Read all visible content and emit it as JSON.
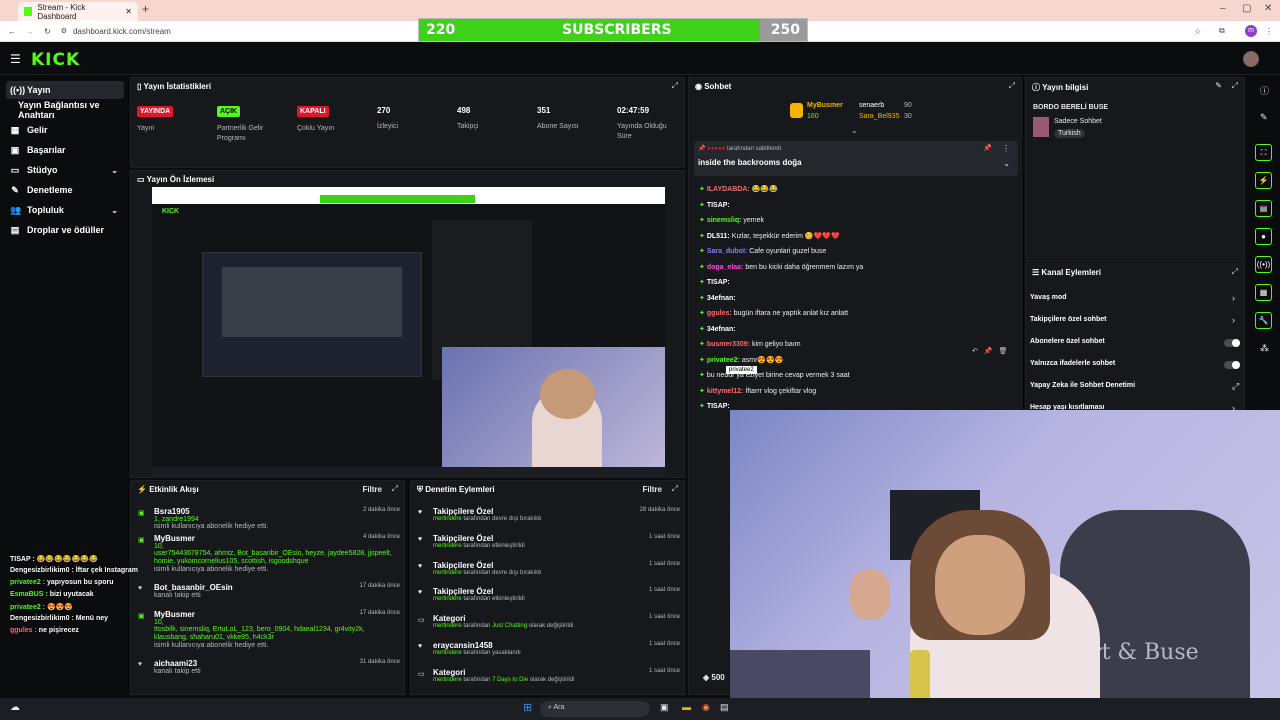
{
  "browser": {
    "tab_title": "Stream - Kick Dashboard",
    "url": "dashboard.kick.com/stream",
    "avatar_letter": "m"
  },
  "sub_overlay": {
    "current": "220",
    "label": "SUBSCRIBERS",
    "goal": "250",
    "progress": 0.88
  },
  "logo": "KICK",
  "sidebar": {
    "items": [
      {
        "label": "Yayın",
        "icon": "broadcast-icon"
      },
      {
        "label": "Yayın Bağlantısı ve Anahtarı",
        "icon": ""
      },
      {
        "label": "Gelir",
        "icon": "revenue-icon"
      },
      {
        "label": "Başarılar",
        "icon": "achievements-icon"
      },
      {
        "label": "Stüdyo",
        "icon": "studio-icon"
      },
      {
        "label": "Denetleme",
        "icon": "moderation-icon"
      },
      {
        "label": "Topluluk",
        "icon": "community-icon"
      },
      {
        "label": "Droplar ve ödüller",
        "icon": "drops-icon"
      }
    ]
  },
  "stats": {
    "title": "Yayın İstatistikleri",
    "items": [
      {
        "badge": "YAYINDA",
        "label": "Yayın"
      },
      {
        "badge": "AÇIK",
        "label": "Partnerlik Gelir Programı"
      },
      {
        "badge": "KAPALI",
        "label": "Çoklu Yayın"
      },
      {
        "value": "270",
        "label": "İzleyici"
      },
      {
        "value": "498",
        "label": "Takipçi"
      },
      {
        "value": "351",
        "label": "Abone Sayısı"
      },
      {
        "value": "02:47:59",
        "label": "Yayında Olduğu Süre"
      }
    ]
  },
  "preview": {
    "title": "Yayın Ön İzlemesi"
  },
  "chat": {
    "title": "Sohbet",
    "leader": {
      "name": "MyBusmer",
      "count": "160"
    },
    "top": [
      {
        "name": "senaerb",
        "count": "90"
      },
      {
        "name": "Sara_Bel935",
        "count": "30"
      }
    ],
    "pinned": {
      "by": "tarafından sabitlendi",
      "text": "inside the backrooms doğa"
    },
    "messages": [
      {
        "user": "ILAYDABDA:",
        "text": "😂😂😂",
        "color": "#ff6b6b"
      },
      {
        "user": "TISAP:",
        "text": "",
        "color": "#ffffff"
      },
      {
        "user": "sinemsliq:",
        "text": "yemek",
        "color": "#53fc18"
      },
      {
        "user": "DL511:",
        "text": "Kızlar, teşekkür ederim 😊❤️❤️❤️",
        "color": "#ffffff"
      },
      {
        "user": "Sara_dubol:",
        "text": "Cafe oyunlari guzel buse",
        "color": "#8f7bff"
      },
      {
        "user": "doga_elaa:",
        "text": "ben bu kicki daha öğrenmem lazım ya",
        "color": "#ff4fd8"
      },
      {
        "user": "TISAP:",
        "text": "",
        "color": "#ffffff"
      },
      {
        "user": "34efnan:",
        "text": "",
        "color": "#ffffff"
      },
      {
        "user": "ggules:",
        "text": "bugün iftara ne yaptık anlat kız anlatt",
        "color": "#ff6b6b"
      },
      {
        "user": "34efnan:",
        "text": "",
        "color": "#ffffff"
      },
      {
        "user": "busmer3309:",
        "text": "kim geliyo baım",
        "color": "#ff6b6b"
      },
      {
        "user": "privatee2:",
        "text": "asmr😍😍😍",
        "color": "#53fc18"
      },
      {
        "user": "",
        "text": "bu nedur ya eziyet birine cevap vermek 3 saat",
        "color": "#ffffff"
      },
      {
        "user": "kittymel12:",
        "text": "İftarrr vlog çekiftar vlog",
        "color": "#ff6b6b"
      },
      {
        "user": "TISAP:",
        "text": "",
        "color": "#ffffff"
      }
    ],
    "tooltip": "privatee2",
    "footer_count": "500"
  },
  "events": {
    "title": "Etkinlik Akışı",
    "filter": "Filtre",
    "items": [
      {
        "name": "Bsra1905",
        "line1": "1, zandre1994",
        "line2": "isimli kullanıcıya abonelik hediye etti.",
        "time": "2 dakika önce"
      },
      {
        "name": "MyBusmer",
        "line1": "10,",
        "line1b": "user75443678754, ahmtz, Bot_basanbir_OEsin, heyze, jaydee5828, jjspeelt, homie, yukomcornelius105, scottish, isgoodshque",
        "line2": "isimli kullanıcıya abonelik hediye etti.",
        "time": "4 dakika önce"
      },
      {
        "name": "Bot_basanbir_OEsin",
        "line2": "kanalı takip etti",
        "time": "17 dakika önce"
      },
      {
        "name": "MyBusmer",
        "line1": "10,",
        "line1b": "ttosbilk, sinemsliq, ErtuLoL_123, bero_0904, hdaeal1234, gr4vity2k, klausbang, shaharu01, vkke95, h4ck3r",
        "line2": "isimli kullanıcıya abonelik hediye etti.",
        "time": "17 dakika önce"
      },
      {
        "name": "aichaami23",
        "line2": "kanalı takip etti",
        "time": "31 dakika önce"
      }
    ]
  },
  "moderation": {
    "title": "Denetim Eylemleri",
    "filter": "Filtre",
    "items": [
      {
        "title": "Takipçilere Özel",
        "user": "mertindere",
        "text": "tarafından devre dışı bırakıldı",
        "time": "28 dakika önce"
      },
      {
        "title": "Takipçilere Özel",
        "user": "mertindere",
        "text": "tarafından etkinleştirildi",
        "time": "1 saat önce"
      },
      {
        "title": "Takipçilere Özel",
        "user": "mertindere",
        "text": "tarafından devre dışı bırakıldı",
        "time": "1 saat önce"
      },
      {
        "title": "Takipçilere Özel",
        "user": "mertindere",
        "text": "tarafından etkinleştirildi",
        "time": "1 saat önce"
      },
      {
        "title": "Kategori",
        "user": "mertindere",
        "text": "tarafından",
        "highlight": "Just Chatting",
        "text2": "olarak değiştirildi",
        "time": "1 saat önce"
      },
      {
        "title": "eraycansin1458",
        "user": "mertindere",
        "text": "tarafından yasaklandı",
        "time": "1 saat önce"
      },
      {
        "title": "Kategori",
        "user": "mertindere",
        "text": "tarafından",
        "highlight": "7 Days to Die",
        "text2": "olarak değiştirildi",
        "time": "1 saat önce"
      }
    ]
  },
  "stream_info": {
    "title": "Yayın bilgisi",
    "stream_title": "BORDO BERELİ BUSE",
    "subtitle": "Sadece Sohbet",
    "tag": "Turkish"
  },
  "channel_actions": {
    "title": "Kanal Eylemleri",
    "items": [
      {
        "label": "Yavaş mod",
        "type": "arrow"
      },
      {
        "label": "Takipçilere özel sohbet",
        "type": "arrow"
      },
      {
        "label": "Abonelere özel sohbet",
        "type": "toggle"
      },
      {
        "label": "Yalnızca ifadelerle sohbet",
        "type": "toggle"
      },
      {
        "label": "Yapay Zeka ile Sohbet Denetimi",
        "type": "external"
      },
      {
        "label": "Hesap yaşı kısıtlaması",
        "type": "arrow"
      }
    ]
  },
  "overlay_chat": [
    {
      "user": "TISAP :",
      "text": "😂😂😂😂😂😂😂",
      "color": "#ffffff"
    },
    {
      "user": "Dengesizbirlikim0 :",
      "text": "İftar çek Instagram",
      "color": "#ffffff"
    },
    {
      "user": "privatee2 :",
      "text": "yapıyosun bu sporu",
      "color": "#53fc18"
    },
    {
      "user": "EsmaBUS :",
      "text": "bizi uyutacak",
      "color": "#53fc18"
    },
    {
      "user": "privatee2 :",
      "text": "😍😍😍",
      "color": "#53fc18"
    },
    {
      "user": "Dengesizbirlikim0 :",
      "text": "Menü ney",
      "color": "#ffffff"
    },
    {
      "user": "ggules :",
      "text": "ne pişirecez",
      "color": "#ff6b6b"
    }
  ],
  "webcam": {
    "chair_text": "Ert & Buse"
  },
  "taskbar": {
    "search": "Ara"
  }
}
